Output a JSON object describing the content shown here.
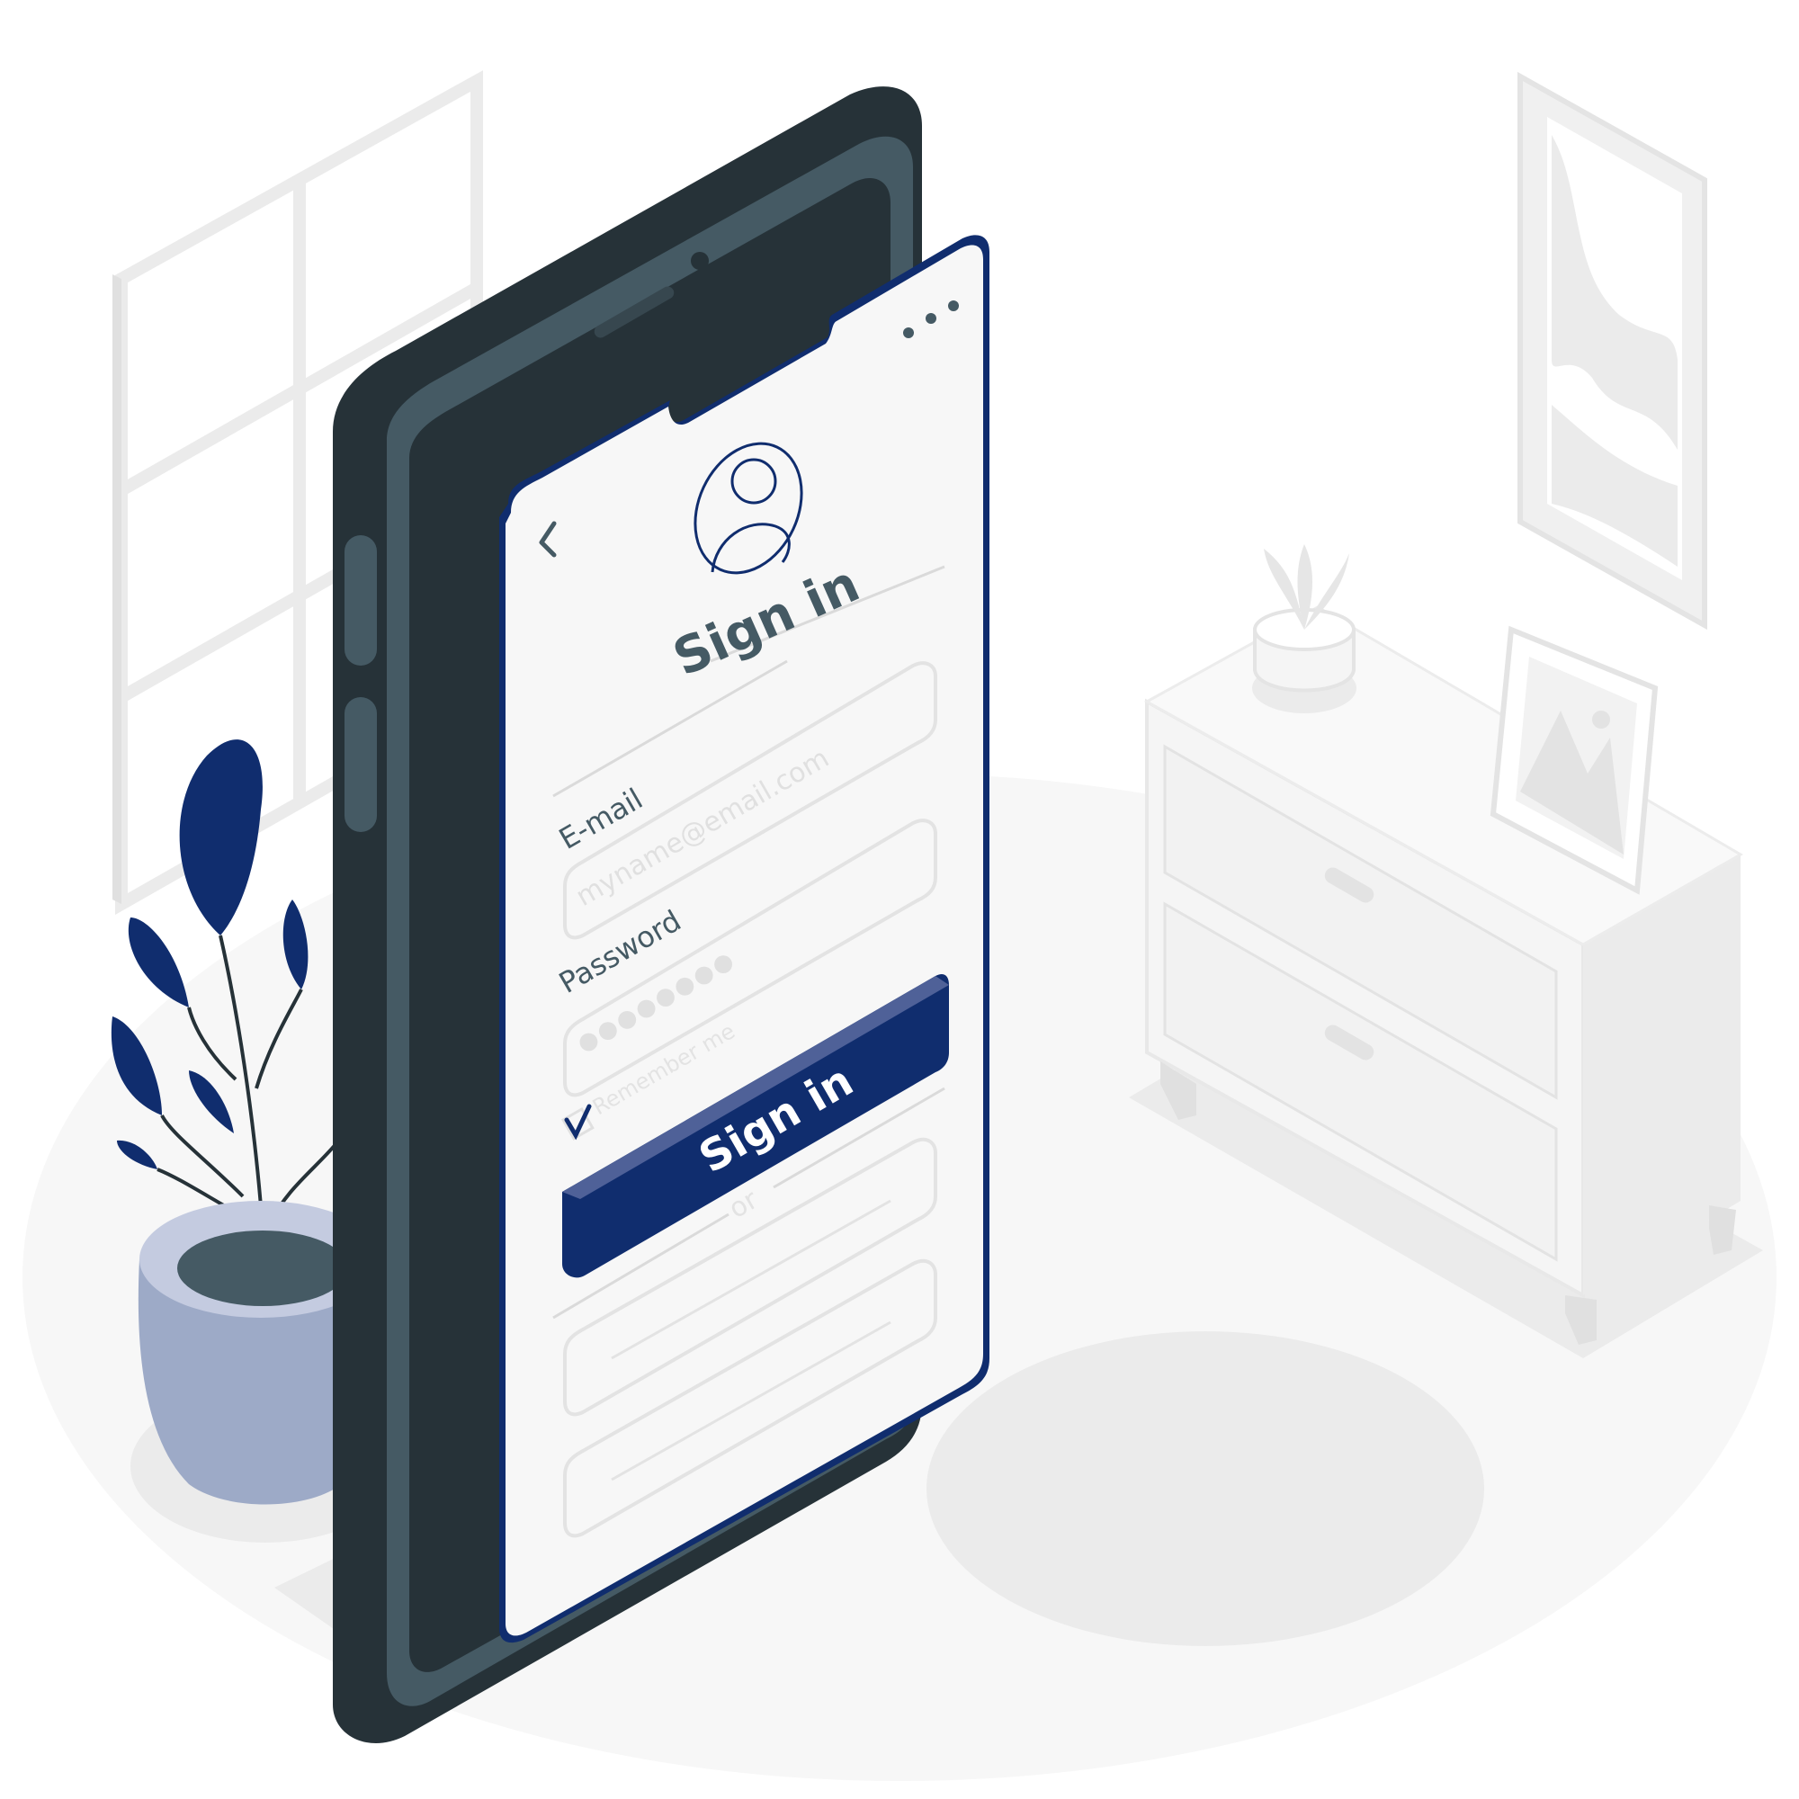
{
  "screen": {
    "title": "Sign in",
    "back_icon": "chevron-left-icon",
    "menu_icon": "more-dots-icon",
    "avatar_icon": "user-icon",
    "email": {
      "label": "E-mail",
      "placeholder": "myname@email.com",
      "value": ""
    },
    "password": {
      "label": "Password",
      "masked_value": "●●●●●●●●"
    },
    "remember": {
      "label": "Remember me",
      "checked": true
    },
    "signin_button": {
      "label": "Sign in"
    },
    "divider": {
      "label": "or"
    }
  },
  "colors": {
    "accent": "#102d6e",
    "accent_light": "#4f6198",
    "phone_body": "#263238",
    "phone_bezel": "#455a64",
    "screen_bg": "#f7f7f7",
    "room_light": "#ebebeb",
    "room_floor": "#f5f5f5",
    "pot": "#9daac7"
  }
}
